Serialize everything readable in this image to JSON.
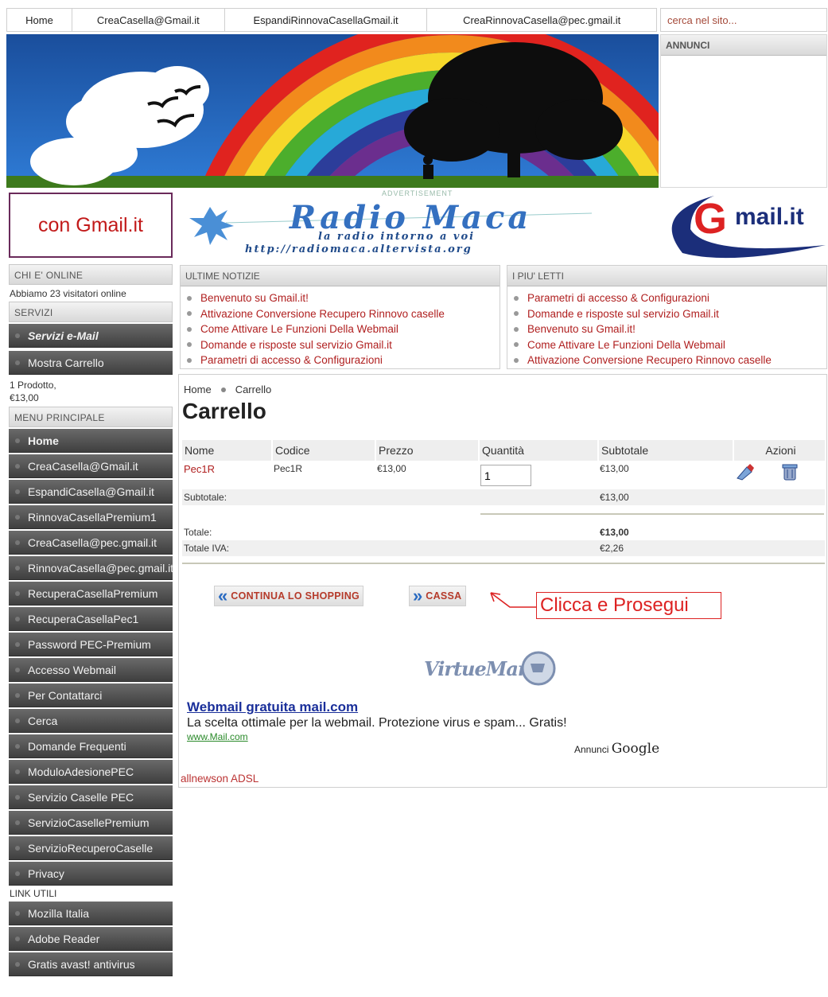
{
  "topnav": {
    "items": [
      "Home",
      "CreaCasella@Gmail.it",
      "EspandiRinnovaCasellaGmail.it",
      "CreaRinnovaCasella@pec.gmail.it"
    ],
    "search_placeholder": "cerca nel sito..."
  },
  "ads": {
    "title": "ANNUNCI"
  },
  "sidebar": {
    "logo_text": "con Gmail.it",
    "online_title": "CHI E' ONLINE",
    "online_text": "Abbiamo 23 visitatori online",
    "services_title": "SERVIZI",
    "services_items": [
      "Servizi e-Mail",
      "Mostra Carrello"
    ],
    "cart_summary_line1": "1 Prodotto,",
    "cart_summary_line2": "€13,00",
    "main_menu_title": "MENU PRINCIPALE",
    "main_menu": [
      "Home",
      "CreaCasella@Gmail.it",
      "EspandiCasella@Gmail.it",
      "RinnovaCasellaPremium1",
      "CreaCasella@pec.gmail.it",
      "RinnovaCasella@pec.gmail.it",
      "RecuperaCasellaPremium",
      "RecuperaCasellaPec1",
      "Password PEC-Premium",
      "Accesso Webmail",
      "Per Contattarci",
      "Cerca",
      "Domande Frequenti",
      "ModuloAdesionePEC",
      "Servizio Caselle PEC",
      "ServizioCasellePremium",
      "ServizioRecuperoCaselle",
      "Privacy"
    ],
    "links_title": "LINK UTILI",
    "links": [
      "Mozilla Italia",
      "Adobe Reader",
      "Gratis avast! antivirus"
    ]
  },
  "adbanner": {
    "label": "ADVERTISEMENT",
    "title": "Radio Maca",
    "subtitle": "la radio intorno a voi",
    "url": "http://radiomaca.altervista.org"
  },
  "gmail_logo": {
    "g": "G",
    "text": "mail.it"
  },
  "news": {
    "title": "ULTIME NOTIZIE",
    "items": [
      "Benvenuto su Gmail.it!",
      "Attivazione Conversione Recupero Rinnovo caselle",
      "Come Attivare Le Funzioni Della Webmail",
      "Domande e risposte sul servizio Gmail.it",
      "Parametri di accesso & Configurazioni"
    ]
  },
  "popular": {
    "title": "I PIU' LETTI",
    "items": [
      "Parametri di accesso & Configurazioni",
      "Domande e risposte sul servizio Gmail.it",
      "Benvenuto su Gmail.it!",
      "Come Attivare Le Funzioni Della Webmail",
      "Attivazione Conversione Recupero Rinnovo caselle"
    ]
  },
  "breadcrumb": {
    "home": "Home",
    "current": "Carrello"
  },
  "page_title": "Carrello",
  "cart": {
    "headers": {
      "name": "Nome",
      "code": "Codice",
      "price": "Prezzo",
      "qty": "Quantità",
      "subtotal": "Subtotale",
      "actions": "Azioni"
    },
    "row": {
      "name": "Pec1R",
      "code": "Pec1R",
      "price": "€13,00",
      "qty": "1",
      "subtotal": "€13,00"
    },
    "subtotal_label": "Subtotale:",
    "subtotal_value": "€13,00",
    "total_label": "Totale:",
    "total_value": "€13,00",
    "vat_label": "Totale IVA:",
    "vat_value": "€2,26"
  },
  "buttons": {
    "continue": "CONTINUA LO SHOPPING",
    "checkout": "CASSA"
  },
  "callout": "Clicca e Prosegui",
  "virtuemart": "VirtueMart",
  "google_ad": {
    "title": "Webmail gratuita mail.com",
    "desc": "La scelta ottimale per la webmail. Protezione virus e spam... Gratis!",
    "url": "www.Mail.com",
    "label": "Annunci",
    "brand": "Google"
  },
  "footer_link": "allnewson ADSL",
  "colors": {
    "link_red": "#b02020",
    "menu_dark": "#4a4a4a",
    "accent_blue": "#2a6bc1",
    "callout_red": "#dd2222"
  }
}
